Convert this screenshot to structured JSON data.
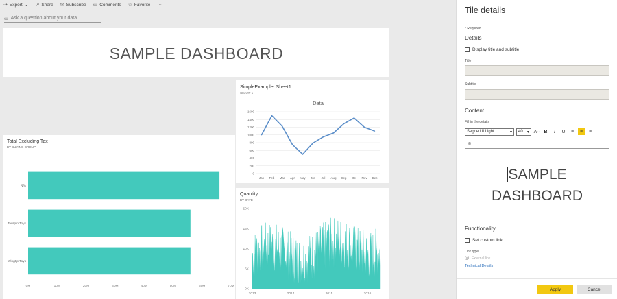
{
  "toolbar": {
    "export": "Export",
    "share": "Share",
    "subscribe": "Subscribe",
    "comments": "Comments",
    "favorite": "Favorite",
    "more": "⋯"
  },
  "qa": {
    "placeholder": "Ask a question about your data"
  },
  "tiles": {
    "main_title": "SAMPLE DASHBOARD",
    "sheet": {
      "title": "SimpleExample, Sheet1",
      "subtitle": "CHART 1"
    },
    "total": {
      "title": "Total Excluding Tax",
      "subtitle": "BY BUYING GROUP"
    },
    "quantity": {
      "title": "Quantity",
      "subtitle": "BY DATE"
    }
  },
  "chart_data": [
    {
      "type": "line",
      "title": "Data",
      "categories": [
        "Jan",
        "Feb",
        "Mar",
        "Apr",
        "May",
        "Jun",
        "Jul",
        "Aug",
        "Sep",
        "Oct",
        "Nov",
        "Dec"
      ],
      "values": [
        1000,
        1500,
        1230,
        750,
        500,
        790,
        950,
        1050,
        1290,
        1440,
        1200,
        1100
      ],
      "ylim": [
        0,
        1600
      ],
      "yticks": [
        "0",
        "200",
        "400",
        "600",
        "800",
        "1000",
        "1200",
        "1400",
        "1600"
      ],
      "color": "#5b8ec9"
    },
    {
      "type": "bar",
      "orientation": "horizontal",
      "categories": [
        "N/A",
        "Tailspin Toys",
        "Wingtip Toys"
      ],
      "values": [
        66,
        56,
        56
      ],
      "unit": "M",
      "xlim": [
        0,
        70
      ],
      "xticks": [
        "0M",
        "10M",
        "20M",
        "30M",
        "40M",
        "50M",
        "60M",
        "70M"
      ],
      "color": "#43c9bc"
    },
    {
      "type": "area",
      "xticks": [
        "2013",
        "2014",
        "2015",
        "2016"
      ],
      "yticks": [
        "0K",
        "5K",
        "10K",
        "15K",
        "20K"
      ],
      "ylim": [
        0,
        20
      ],
      "unit": "K",
      "color": "#43c9bc",
      "series_note": "daily quantity, min ~2K to max ~18K, trending slightly upward"
    }
  ],
  "panel": {
    "title": "Tile details",
    "required": "* Required",
    "details": "Details",
    "display_title": "Display title and subtitle",
    "title_label": "Title",
    "subtitle_label": "Subtitle",
    "content": "Content",
    "fill_in": "Fill in the details",
    "font": "Segoe UI Light",
    "size": "40",
    "editor_line1": "SAMPLE",
    "editor_line2": "DASHBOARD",
    "functionality": "Functionality",
    "custom_link": "Set custom link",
    "link_type": "Link type",
    "external_link": "External link",
    "technical": "Technical Details",
    "apply": "Apply",
    "cancel": "Cancel"
  }
}
